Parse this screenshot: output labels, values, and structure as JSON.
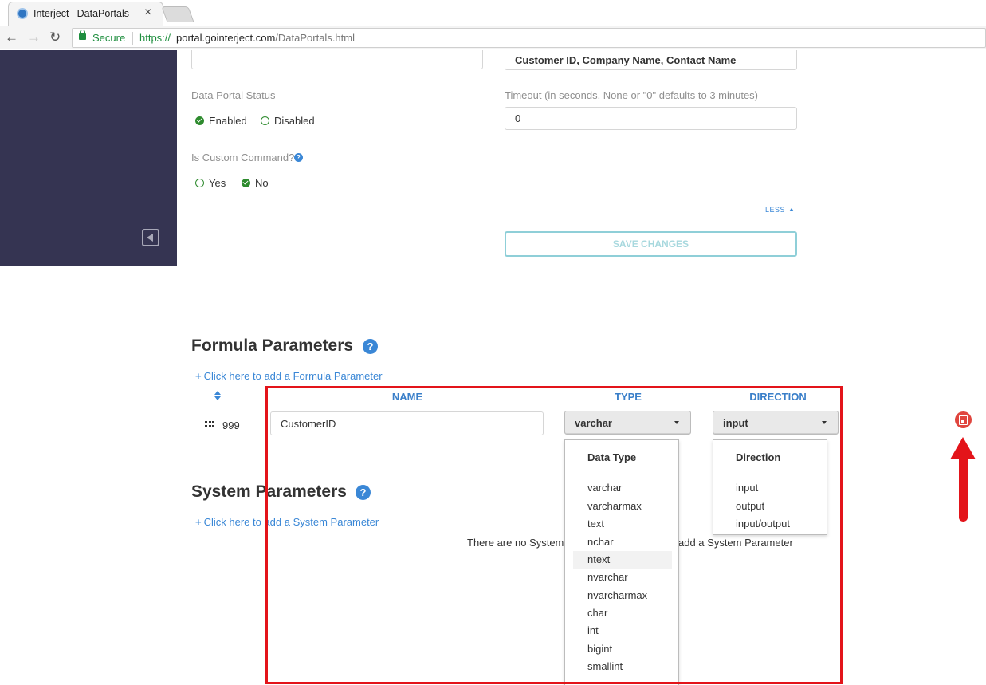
{
  "browser": {
    "tab_title": "Interject | DataPortals",
    "tab_close": "×",
    "nav_back": "←",
    "nav_forward": "→",
    "nav_reload": "↻",
    "secure_label": "Secure",
    "url_scheme": "https://",
    "url_host": "portal.gointerject.com",
    "url_path": "/DataPortals.html"
  },
  "form": {
    "partial_field_value": "",
    "display_columns_value": "Customer ID, Company Name, Contact Name",
    "status_label": "Data Portal Status",
    "status_options": [
      {
        "label": "Enabled",
        "checked": true
      },
      {
        "label": "Disabled",
        "checked": false
      }
    ],
    "timeout_label": "Timeout (in seconds. None or \"0\" defaults to 3 minutes)",
    "timeout_value": "0",
    "custom_command_label": "Is Custom Command?",
    "custom_command_options": [
      {
        "label": "Yes",
        "checked": false
      },
      {
        "label": "No",
        "checked": true
      }
    ],
    "help_glyph": "?",
    "less_label": "LESS",
    "save_changes_label": "SAVE CHANGES"
  },
  "formula_parameters": {
    "title": "Formula Parameters",
    "add_label": "Click here to add a Formula Parameter",
    "columns": [
      "NAME",
      "TYPE",
      "DIRECTION"
    ],
    "row": {
      "order": "999",
      "name": "CustomerID",
      "type": "varchar",
      "direction": "input"
    }
  },
  "type_dropdown": {
    "header": "Data Type",
    "items": [
      "varchar",
      "varcharmax",
      "text",
      "nchar",
      "ntext",
      "nvarchar",
      "nvarcharmax",
      "char",
      "int",
      "bigint",
      "smallint"
    ],
    "hovered": "ntext"
  },
  "direction_dropdown": {
    "header": "Direction",
    "items": [
      "input",
      "output",
      "input/output"
    ]
  },
  "system_parameters": {
    "title": "System Parameters",
    "add_label": "Click here to add a System Parameter",
    "empty_message_part1": "There are no System P",
    "empty_message_part2": "add a System Parameter"
  },
  "colors": {
    "sidebar": "#353452",
    "accent": "#3a87d6",
    "annotation": "#e3141a",
    "status_green": "#2e8b2e"
  }
}
